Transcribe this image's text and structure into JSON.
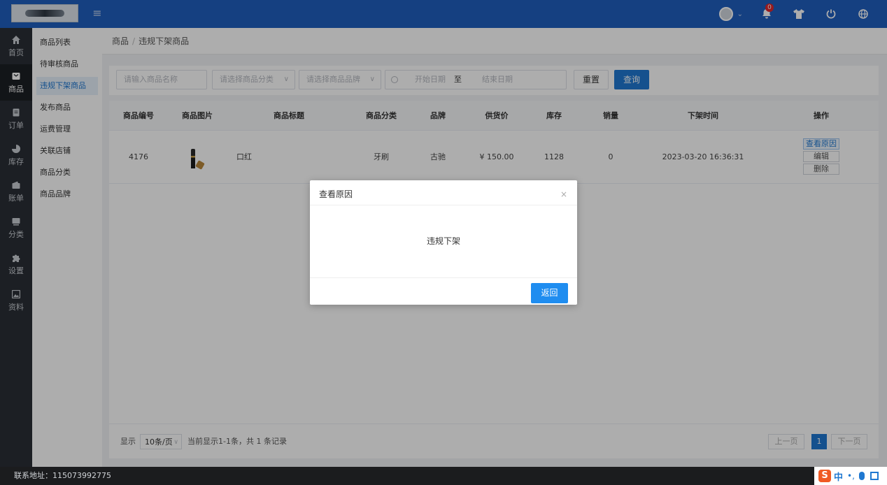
{
  "topbar": {
    "notification_count": "0",
    "icons": [
      "hamburger-menu-icon",
      "user-avatar",
      "chevron-down-icon",
      "bell-icon",
      "shirt-icon",
      "power-icon",
      "globe-icon"
    ]
  },
  "rail": [
    {
      "label": "首页",
      "icon": "home-icon"
    },
    {
      "label": "商品",
      "icon": "goods-icon",
      "active": true
    },
    {
      "label": "订单",
      "icon": "order-icon"
    },
    {
      "label": "库存",
      "icon": "pie-chart-icon"
    },
    {
      "label": "账单",
      "icon": "wallet-icon"
    },
    {
      "label": "分类",
      "icon": "category-icon"
    },
    {
      "label": "设置",
      "icon": "puzzle-icon"
    },
    {
      "label": "资料",
      "icon": "image-icon"
    }
  ],
  "submenu": [
    {
      "label": "商品列表"
    },
    {
      "label": "待审核商品"
    },
    {
      "label": "违规下架商品",
      "active": true
    },
    {
      "label": "发布商品"
    },
    {
      "label": "运费管理"
    },
    {
      "label": "关联店铺"
    },
    {
      "label": "商品分类"
    },
    {
      "label": "商品品牌"
    }
  ],
  "breadcrumb": {
    "root": "商品",
    "separator": "/",
    "current": "违规下架商品"
  },
  "filter": {
    "name_placeholder": "请输入商品名称",
    "category_placeholder": "请选择商品分类",
    "brand_placeholder": "请选择商品品牌",
    "start_date_placeholder": "开始日期",
    "range_sep": "至",
    "end_date_placeholder": "结束日期",
    "reset_label": "重置",
    "query_label": "查询"
  },
  "table": {
    "headers": [
      "商品编号",
      "商品图片",
      "商品标题",
      "商品分类",
      "品牌",
      "供货价",
      "库存",
      "销量",
      "下架时间",
      "操作"
    ],
    "rows": [
      {
        "id": "4176",
        "title": "口红",
        "category": "牙刷",
        "brand": "古驰",
        "price": "¥ 150.00",
        "stock": "1128",
        "sales": "0",
        "offline_time": "2023-03-20 16:36:31",
        "ops": [
          "查看原因",
          "编辑",
          "删除"
        ]
      }
    ]
  },
  "pager": {
    "show_label": "显示",
    "page_size": "10条/页",
    "summary": "当前显示1-1条，共 1 条记录",
    "prev": "上一页",
    "current": "1",
    "next": "下一页"
  },
  "modal": {
    "title": "查看原因",
    "close": "×",
    "body": "违规下架",
    "back_label": "返回"
  },
  "footer": {
    "contact": "联系地址：115073992775"
  },
  "ime": {
    "s": "S",
    "zh": "中",
    "punct": "•,"
  }
}
